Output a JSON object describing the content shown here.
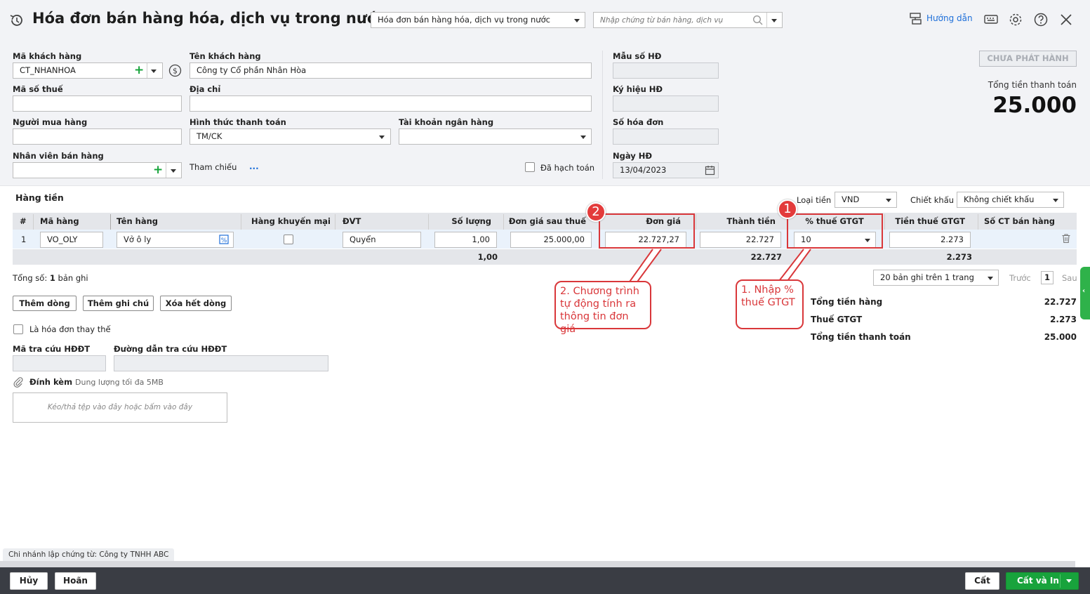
{
  "header": {
    "title": "Hóa đơn bán hàng hóa, dịch vụ trong nước",
    "type_select": "Hóa đơn bán hàng hóa, dịch vụ trong nước",
    "search_placeholder": "Nhập chứng từ bán hàng, dịch vụ",
    "help_label": "Hướng dẫn"
  },
  "form": {
    "customer_code_label": "Mã khách hàng",
    "customer_code": "CT_NHANHOA",
    "customer_name_label": "Tên khách hàng",
    "customer_name": "Công ty Cổ phần Nhân Hòa",
    "tax_code_label": "Mã số thuế",
    "tax_code": "",
    "address_label": "Địa chỉ",
    "address": "",
    "buyer_label": "Người mua hàng",
    "buyer": "",
    "payment_label": "Hình thức thanh toán",
    "payment": "TM/CK",
    "bank_label": "Tài khoản ngân hàng",
    "bank": "",
    "salesperson_label": "Nhân viên bán hàng",
    "salesperson": "",
    "reference_label": "Tham chiếu",
    "reference_more": "...",
    "accounted_label": "Đã hạch toán",
    "form_no_label": "Mẫu số HĐ",
    "symbol_label": "Ký hiệu HĐ",
    "invoice_no_label": "Số hóa đơn",
    "date_label": "Ngày HĐ",
    "date": "13/04/2023"
  },
  "status": {
    "badge": "CHƯA PHÁT HÀNH",
    "total_label": "Tổng tiền thanh toán",
    "total_value": "25.000"
  },
  "goods": {
    "section_title": "Hàng tiền",
    "currency_label": "Loại tiền",
    "currency": "VND",
    "discount_label": "Chiết khấu",
    "discount": "Không chiết khấu",
    "columns": [
      "#",
      "Mã hàng",
      "Tên hàng",
      "Hàng khuyến mại",
      "ĐVT",
      "Số lượng",
      "Đơn giá sau thuế",
      "Đơn giá",
      "Thành tiền",
      "% thuế GTGT",
      "Tiền thuế GTGT",
      "Số CT bán hàng"
    ],
    "row": {
      "index": "1",
      "code": "VO_OLY",
      "name": "Vở ô ly",
      "unit": "Quyển",
      "qty": "1,00",
      "price_after_tax": "25.000,00",
      "price": "22.727,27",
      "amount": "22.727",
      "vat_rate": "10",
      "vat_amount": "2.273"
    },
    "totals": {
      "qty": "1,00",
      "amount": "22.727",
      "vat": "2.273"
    },
    "record_count_prefix": "Tổng số:",
    "record_count": "1",
    "record_count_suffix": "bản ghi",
    "page_size": "20 bản ghi trên 1 trang",
    "prev": "Trước",
    "page": "1",
    "next": "Sau"
  },
  "actions": {
    "add_row": "Thêm dòng",
    "add_note": "Thêm ghi chú",
    "delete_rows": "Xóa hết dòng"
  },
  "extra": {
    "replacement_label": "Là hóa đơn thay thế",
    "lookup_code_label": "Mã tra cứu HĐĐT",
    "lookup_url_label": "Đường dẫn tra cứu HĐĐT",
    "attach_label": "Đính kèm",
    "attach_hint": "Dung lượng tối đa 5MB",
    "drop_text": "Kéo/thả tệp vào đây hoặc bấm vào đây"
  },
  "summary": {
    "goods_label": "Tổng tiền hàng",
    "goods_value": "22.727",
    "vat_label": "Thuế GTGT",
    "vat_value": "2.273",
    "total_label": "Tổng tiền thanh toán",
    "total_value": "25.000"
  },
  "annotations": {
    "badge1": "1",
    "badge2": "2",
    "callout1": "1. Nhập % thuế GTGT",
    "callout2": "2. Chương trình tự động tính ra thông tin đơn giá"
  },
  "branch": "Chi nhánh lập chứng từ: Công ty TNHH ABC",
  "footer": {
    "cancel": "Hủy",
    "undo": "Hoãn",
    "save": "Cất",
    "save_print": "Cất và In"
  },
  "colors": {
    "accent_blue": "#1e6fd9",
    "green": "#17a43b",
    "annotation_red": "#d9373a",
    "footer_bg": "#3a3d44"
  }
}
